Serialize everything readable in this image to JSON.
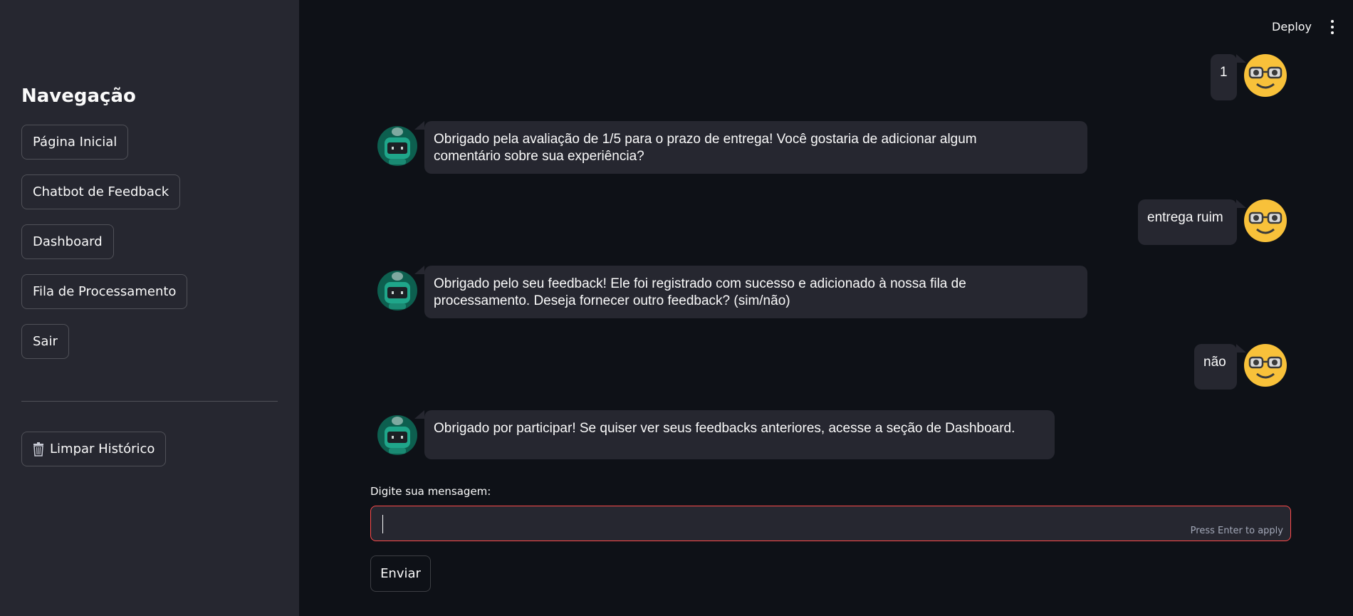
{
  "sidebar": {
    "title": "Navegação",
    "items": [
      {
        "label": "Página Inicial"
      },
      {
        "label": "Chatbot de Feedback"
      },
      {
        "label": "Dashboard"
      },
      {
        "label": "Fila de Processamento"
      },
      {
        "label": "Sair"
      }
    ],
    "clear_label": "Limpar Histórico",
    "clear_icon": "trash-icon"
  },
  "header": {
    "deploy_label": "Deploy",
    "menu_icon": "more-vertical-icon"
  },
  "chat": {
    "messages": [
      {
        "role": "user",
        "text": "1",
        "avatar": "nerd-face-emoji"
      },
      {
        "role": "assistant",
        "line1": "Obrigado pela avaliação de 1/5 para o prazo de entrega! Você gostaria de adicionar algum",
        "line2": "comentário sobre sua experiência?",
        "avatar": "robot-avatar"
      },
      {
        "role": "user",
        "text": "entrega ruim",
        "avatar": "nerd-face-emoji"
      },
      {
        "role": "assistant",
        "line1": "Obrigado pelo seu feedback! Ele foi registrado com sucesso e adicionado à nossa fila de",
        "line2": "processamento. Deseja fornecer outro feedback? (sim/não)",
        "avatar": "robot-avatar"
      },
      {
        "role": "user",
        "text": "não",
        "avatar": "nerd-face-emoji"
      },
      {
        "role": "assistant",
        "line1": "Obrigado por participar! Se quiser ver seus feedbacks anteriores, acesse a seção de Dashboard.",
        "avatar": "robot-avatar"
      }
    ]
  },
  "input": {
    "label": "Digite sua mensagem:",
    "value": "",
    "hint": "Press Enter to apply",
    "send_label": "Enviar"
  },
  "colors": {
    "background": "#0e1117",
    "sidebar": "#262730",
    "bubble": "#262730",
    "focus_border": "#ff4b4b"
  }
}
